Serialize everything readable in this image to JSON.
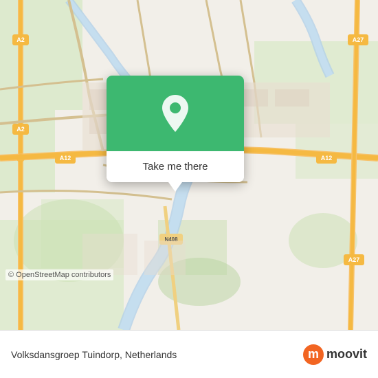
{
  "map": {
    "background_color": "#e8e0d8",
    "copyright": "© OpenStreetMap contributors"
  },
  "popup": {
    "button_label": "Take me there",
    "pin_color": "#ffffff",
    "background_color": "#3db870"
  },
  "bottom_bar": {
    "location_text": "Volksdansgroep Tuindorp, Netherlands",
    "logo_letter": "m",
    "logo_text": "moovit"
  }
}
